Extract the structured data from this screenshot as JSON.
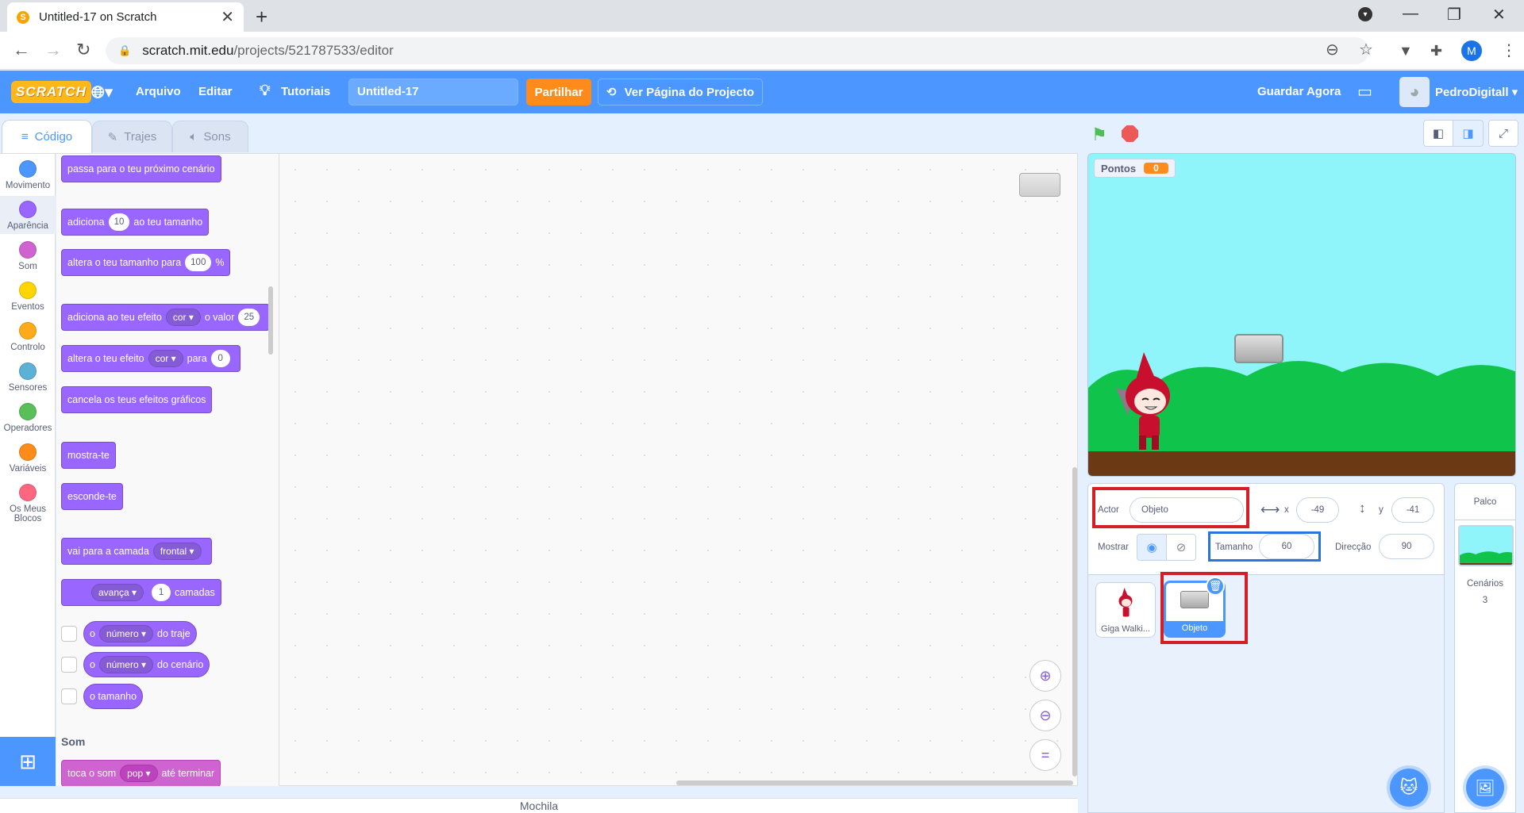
{
  "browser": {
    "tab_title": "Untitled-17 on Scratch",
    "url_host": "scratch.mit.edu",
    "url_path": "/projects/521787533/editor",
    "profile_initial": "M"
  },
  "menubar": {
    "logo": "SCRATCH",
    "file": "Arquivo",
    "edit": "Editar",
    "tutorials": "Tutoriais",
    "project_title": "Untitled-17",
    "share": "Partilhar",
    "see_project_page": "Ver Página do Projecto",
    "save_now": "Guardar Agora",
    "username": "PedroDigitall"
  },
  "editor_tabs": {
    "code": "Código",
    "costumes": "Trajes",
    "sounds": "Sons"
  },
  "categories": [
    {
      "label": "Movimento",
      "color": "#4c97ff"
    },
    {
      "label": "Aparência",
      "color": "#9966ff"
    },
    {
      "label": "Som",
      "color": "#cf63cf"
    },
    {
      "label": "Eventos",
      "color": "#ffd500"
    },
    {
      "label": "Controlo",
      "color": "#ffab19"
    },
    {
      "label": "Sensores",
      "color": "#5cb1d6"
    },
    {
      "label": "Operadores",
      "color": "#59c059"
    },
    {
      "label": "Variáveis",
      "color": "#ff8c1a"
    },
    {
      "label": "Os Meus Blocos",
      "color": "#ff6680"
    }
  ],
  "palette": {
    "next_backdrop": "passa para o teu próximo cenário",
    "change_size": {
      "a": "adiciona",
      "val": "10",
      "b": "ao teu tamanho"
    },
    "set_size": {
      "a": "altera o teu tamanho para",
      "val": "100",
      "b": "%"
    },
    "change_effect": {
      "a": "adiciona ao teu efeito",
      "dd": "cor",
      "b": "o valor",
      "val": "25"
    },
    "set_effect": {
      "a": "altera o teu efeito",
      "dd": "cor",
      "b": "para",
      "val": "0"
    },
    "clear_effects": "cancela os teus efeitos gráficos",
    "show": "mostra-te",
    "hide": "esconde-te",
    "go_to_layer": {
      "a": "vai para a camada",
      "dd": "frontal"
    },
    "go_layers": {
      "dd": "avança",
      "val": "1",
      "b": "camadas"
    },
    "costume_number": {
      "a": "o",
      "dd": "número",
      "b": "do traje"
    },
    "backdrop_number": {
      "a": "o",
      "dd": "número",
      "b": "do cenário"
    },
    "size_reporter": "o tamanho",
    "sound_section": "Som",
    "play_sound": {
      "a": "toca o som",
      "dd": "pop",
      "b": "até terminar"
    }
  },
  "stage": {
    "monitor_label": "Pontos",
    "monitor_value": "0"
  },
  "sprite_info": {
    "sprite_label": "Actor",
    "sprite_name": "Objeto",
    "x_label": "x",
    "x_value": "-49",
    "y_label": "y",
    "y_value": "-41",
    "show_label": "Mostrar",
    "size_label": "Tamanho",
    "size_value": "60",
    "direction_label": "Direcção",
    "direction_value": "90"
  },
  "sprites": [
    {
      "name": "Giga Walki..."
    },
    {
      "name": "Objeto",
      "selected": true
    }
  ],
  "stage_panel": {
    "title": "Palco",
    "backdrops_label": "Cenários",
    "backdrops_count": "3"
  },
  "backpack": "Mochila"
}
